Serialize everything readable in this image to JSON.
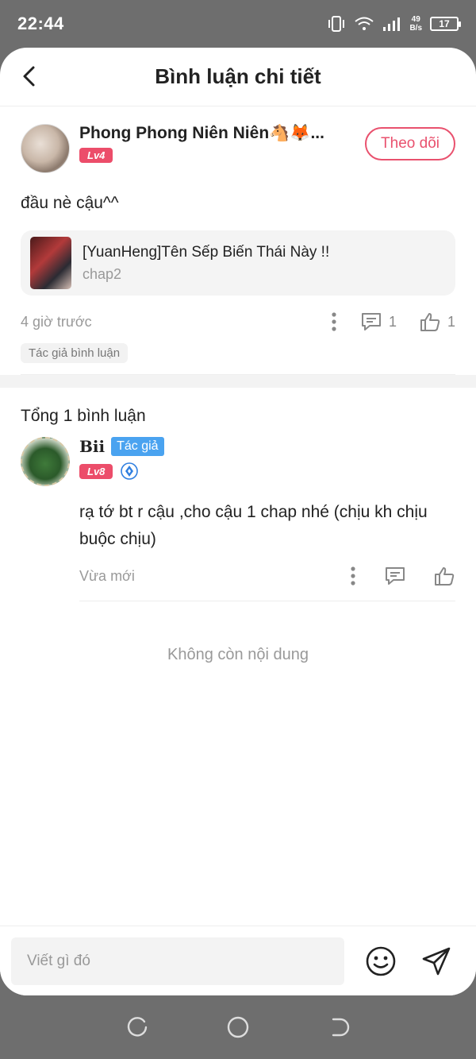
{
  "status_bar": {
    "time": "22:44",
    "net_speed_value": "49",
    "net_speed_unit": "B/s",
    "battery": "17"
  },
  "header": {
    "title": "Bình luận chi tiết"
  },
  "post": {
    "author_name": "Phong Phong Niên Niên🐴🦊...",
    "level": "Lv4",
    "follow_label": "Theo dõi",
    "text": "đầu nè cậu^^",
    "chapter_title": "[YuanHeng]Tên Sếp Biến Thái Này !!",
    "chapter_sub": "chap2",
    "time": "4 giờ trước",
    "reply_count": "1",
    "like_count": "1",
    "tag": "Tác giả bình luận"
  },
  "comments_section": {
    "total": "Tổng 1 bình luận",
    "comments": [
      {
        "name": "Bii",
        "author_badge": "Tác giả",
        "level": "Lv8",
        "text": "rạ tớ bt r cậu ,cho cậu 1 chap nhé (chịu kh chịu buộc chịu)",
        "time": "Vừa mới"
      }
    ],
    "end_text": "Không còn nội dung"
  },
  "input_bar": {
    "placeholder": "Viết gì đó"
  },
  "colors": {
    "accent": "#e9516e",
    "level_badge": "#ec4d6a",
    "author_badge": "#4aa3f0"
  }
}
